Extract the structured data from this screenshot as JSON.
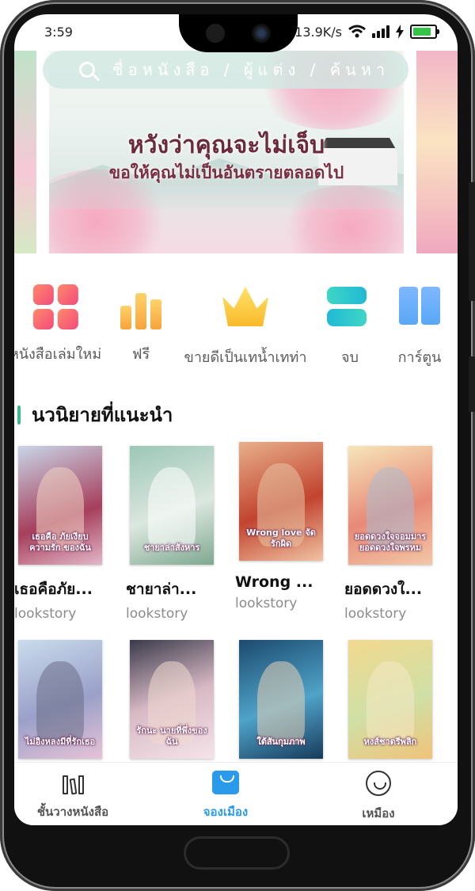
{
  "status_bar": {
    "time": "3:59",
    "network_speed": "13.9K/s",
    "battery_level": 0.85
  },
  "search": {
    "placeholder": "ชื่อหนังสือ / ผู้แต่ง / ค้นหา"
  },
  "banner": {
    "title": "หวังว่าคุณจะไม่เจ็บ",
    "subtitle": "ขอให้คุณไม่เป็นอันตรายตลอดไป"
  },
  "categories": [
    {
      "label": "หนังสือเล่มใหม่",
      "icon": "new-books-grid-icon"
    },
    {
      "label": "ฟรี",
      "icon": "free-bars-icon"
    },
    {
      "label": "ขายดีเป็นเทน้ำเทท่า",
      "icon": "bestseller-crown-icon"
    },
    {
      "label": "จบ",
      "icon": "finished-s-icon"
    },
    {
      "label": "การ์ตูน",
      "icon": "comic-book-icon"
    }
  ],
  "recommended": {
    "title": "นวนิยายที่แนะนำ",
    "books": [
      {
        "title": "เธอคือภัย...",
        "author": "lookstory",
        "cover_text": "เธอคือ ภัยเงียบความรัก ของฉัน"
      },
      {
        "title": "ชายาล่า...",
        "author": "lookstory",
        "cover_text": "ชายาล่าสังหาร"
      },
      {
        "title": "Wrong ...",
        "author": "lookstory",
        "cover_text": "Wrong love จัดรักผิด"
      },
      {
        "title": "ยอดดวงใ...",
        "author": "lookstory",
        "cover_text": "ยอดดวงใจจอมมาร ยอดดวงใจพรหม"
      },
      {
        "title": "",
        "author": "",
        "cover_text": "ไม่อิงหลงมีที่รักเธอ"
      },
      {
        "title": "",
        "author": "",
        "cover_text": "รักนะ นายที่พึ่งของฉัน"
      },
      {
        "title": "",
        "author": "",
        "cover_text": "ใต้สันกุมภาพ"
      },
      {
        "title": "",
        "author": "",
        "cover_text": "หงส์ชาตรีพลิก"
      }
    ]
  },
  "bottom_nav": {
    "shelf": "ชั้นวางหนังสือ",
    "city": "จองเมือง",
    "profile": "เหมือง",
    "active": "city"
  },
  "colors": {
    "accent_blue": "#2a9bea",
    "section_accent": "#3fba8c"
  }
}
